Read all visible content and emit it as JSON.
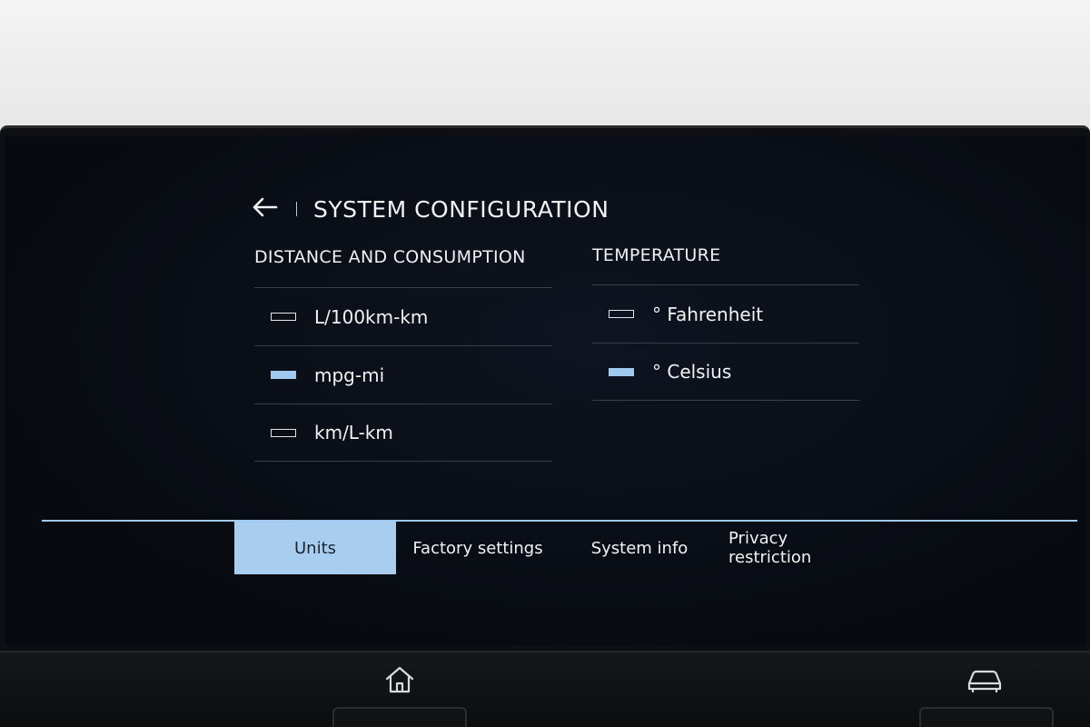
{
  "header": {
    "title": "SYSTEM CONFIGURATION"
  },
  "distance": {
    "heading": "DISTANCE AND CONSUMPTION",
    "options": [
      {
        "label": "L/100km-km",
        "selected": false
      },
      {
        "label": "mpg-mi",
        "selected": true
      },
      {
        "label": "km/L-km",
        "selected": false
      }
    ]
  },
  "temperature": {
    "heading": "TEMPERATURE",
    "options": [
      {
        "label": "° Fahrenheit",
        "selected": false
      },
      {
        "label": "° Celsius",
        "selected": true
      }
    ]
  },
  "tabs": [
    {
      "label": "Units",
      "active": true
    },
    {
      "label": "Factory settings",
      "active": false
    },
    {
      "label": "System info",
      "active": false
    },
    {
      "label": "Privacy restriction",
      "active": false
    }
  ],
  "icons": {
    "back": "arrow-left-icon",
    "home": "home-icon",
    "car": "car-icon"
  },
  "colors": {
    "accent": "#9fc9ef",
    "active_tab": "#a9cdee"
  }
}
